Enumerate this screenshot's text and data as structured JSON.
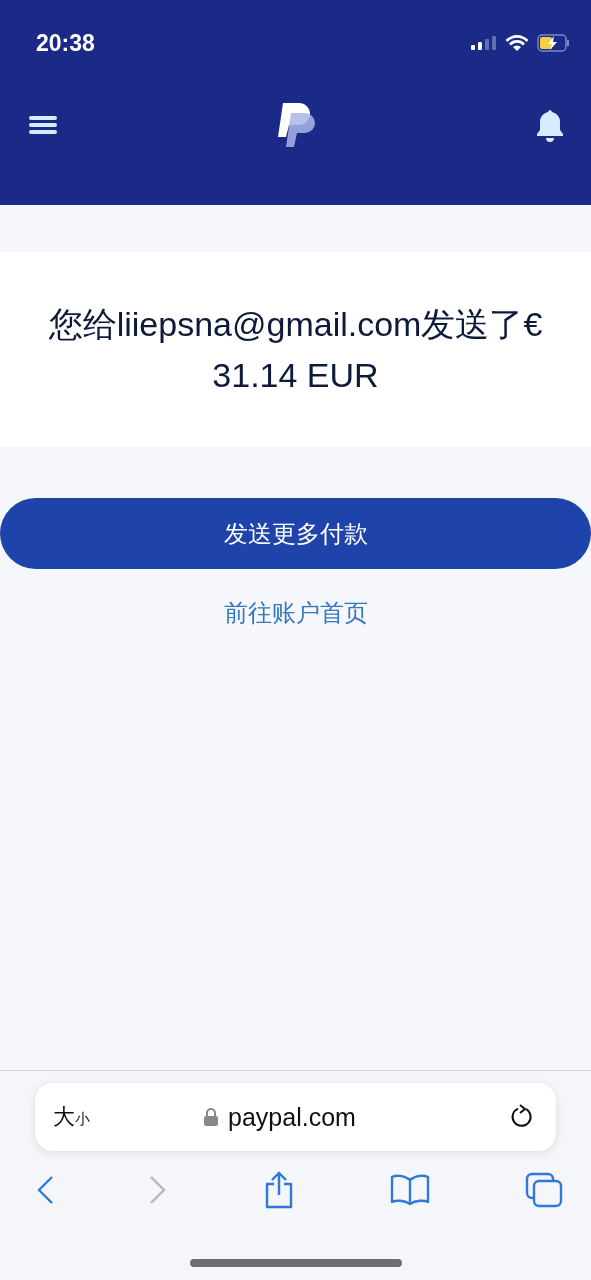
{
  "status_bar": {
    "time": "20:38"
  },
  "message": "您给liiepsna@gmail.com发送了€ 31.14 EUR",
  "buttons": {
    "primary": "发送更多付款",
    "link": "前往账户首页"
  },
  "browser": {
    "text_size_large": "大",
    "text_size_small": "小",
    "url": "paypal.com",
    "back_disabled": false,
    "forward_disabled": true
  }
}
